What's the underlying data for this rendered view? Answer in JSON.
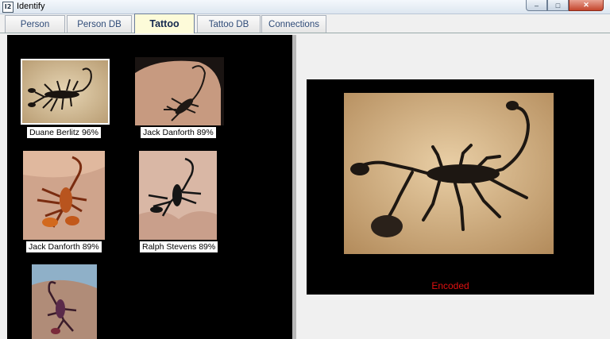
{
  "window": {
    "title": "Identify",
    "app_icon_text": "I2"
  },
  "tabs": [
    {
      "label": "Person"
    },
    {
      "label": "Person DB"
    },
    {
      "label": "Tattoo",
      "active": true
    },
    {
      "label": "Tattoo DB"
    },
    {
      "label": "Connections"
    }
  ],
  "results": [
    {
      "caption": "Duane Berlitz 96%",
      "icon": "scorpion-tattoo-thumbnail"
    },
    {
      "caption": "Jack Danforth 89%",
      "icon": "scorpion-tattoo-thumbnail"
    },
    {
      "caption": "Jack Danforth 89%",
      "icon": "scorpion-tattoo-thumbnail"
    },
    {
      "caption": "Ralph Stevens 89%",
      "icon": "scorpion-tattoo-thumbnail"
    },
    {
      "caption": "",
      "icon": "scorpion-tattoo-thumbnail"
    }
  ],
  "preview": {
    "status": "Encoded",
    "status_color": "#e01010",
    "icon": "scorpion-tattoo-image"
  }
}
